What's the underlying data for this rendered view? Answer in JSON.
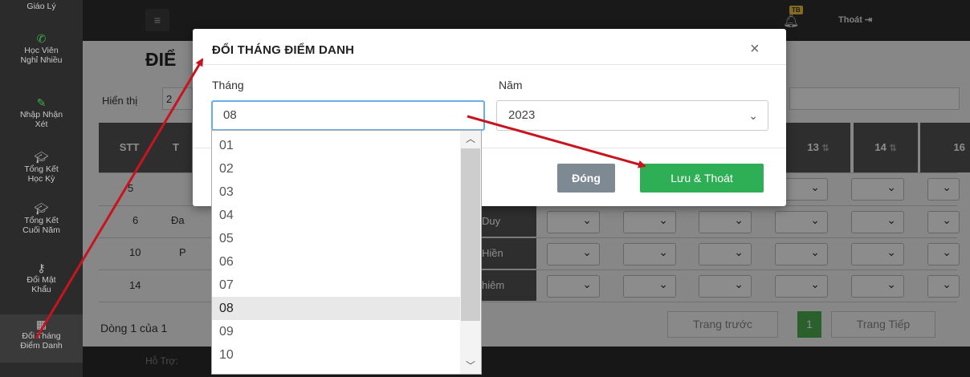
{
  "sidebar": {
    "items": [
      {
        "label": "Giáo Lý",
        "icon": ""
      },
      {
        "label": "Học Viên Nghỉ Nhiều",
        "icon": "phone-icon"
      },
      {
        "label": "Nhập Nhận Xét",
        "icon": "edit-icon"
      },
      {
        "label": "Tổng Kết Học Kỳ",
        "icon": "graduation-cap-icon"
      },
      {
        "label": "Tổng Kết Cuối Năm",
        "icon": "graduation-cap-icon"
      },
      {
        "label": "Đổi Mật Khẩu",
        "icon": "key-icon"
      },
      {
        "label": "Đổi Tháng Điểm Danh",
        "icon": "calendar-icon"
      }
    ]
  },
  "topbar": {
    "badge": "TB",
    "logout_label": "Thoát"
  },
  "background": {
    "title_fragment": "ĐIỂ",
    "show_label": "Hiển thị",
    "show_value_fragment": "2",
    "headers": {
      "stt": "STT",
      "col_fragment": "T",
      "day_13": "13",
      "day_14": "14",
      "day_16": "16"
    },
    "rows": [
      {
        "stt": "5",
        "name_fragment": "",
        "cell_fragment": ""
      },
      {
        "stt": "6",
        "name_fragment": "Đa",
        "cell_fragment": "Duy"
      },
      {
        "stt": "10",
        "name_fragment": "P",
        "cell_fragment": "Hiền"
      },
      {
        "stt": "14",
        "name_fragment": "",
        "cell_fragment": "hiêm"
      }
    ],
    "count_text": "Dòng 1 của 1",
    "pager": {
      "prev": "Trang trước",
      "current": "1",
      "next": "Trang Tiếp"
    },
    "support_label": "Hỗ Trợ:"
  },
  "modal": {
    "title": "ĐỔI THÁNG ĐIỂM DANH",
    "month_label": "Tháng",
    "month_value": "08",
    "year_label": "Năm",
    "year_value": "2023",
    "close_button": "Đóng",
    "save_button": "Lưu & Thoát"
  },
  "month_options": [
    "01",
    "02",
    "03",
    "04",
    "05",
    "06",
    "07",
    "08",
    "09",
    "10"
  ],
  "selected_month": "08",
  "colors": {
    "annotation_arrow": "#c8141e",
    "save_button": "#2eae55",
    "close_button": "#7d8a94",
    "focus_border": "#66afe9"
  }
}
